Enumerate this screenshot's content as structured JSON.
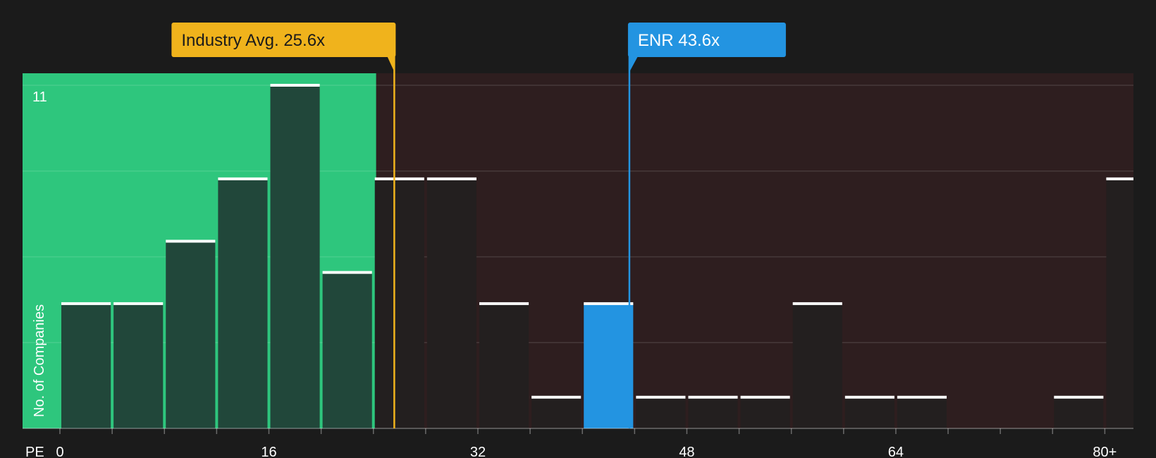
{
  "chart_data": {
    "type": "bar",
    "xlabel": "PE",
    "ylabel": "No. of Companies",
    "y_top_tick": "11",
    "ylim": [
      0,
      11.4
    ],
    "x_ticks": [
      {
        "value": 0,
        "label": "0"
      },
      {
        "value": 16,
        "label": "16"
      },
      {
        "value": 32,
        "label": "32"
      },
      {
        "value": 48,
        "label": "48"
      },
      {
        "value": 64,
        "label": "64"
      },
      {
        "value": 80,
        "label": "80+"
      }
    ],
    "bins": [
      {
        "x0": 0,
        "x1": 4,
        "count": 4
      },
      {
        "x0": 4,
        "x1": 8,
        "count": 4
      },
      {
        "x0": 8,
        "x1": 12,
        "count": 6
      },
      {
        "x0": 12,
        "x1": 16,
        "count": 8
      },
      {
        "x0": 16,
        "x1": 20,
        "count": 11
      },
      {
        "x0": 20,
        "x1": 24,
        "count": 5
      },
      {
        "x0": 24,
        "x1": 28,
        "count": 8
      },
      {
        "x0": 28,
        "x1": 32,
        "count": 8
      },
      {
        "x0": 32,
        "x1": 36,
        "count": 4
      },
      {
        "x0": 36,
        "x1": 40,
        "count": 1
      },
      {
        "x0": 40,
        "x1": 44,
        "count": 4,
        "highlight": true
      },
      {
        "x0": 44,
        "x1": 48,
        "count": 1
      },
      {
        "x0": 48,
        "x1": 52,
        "count": 1
      },
      {
        "x0": 52,
        "x1": 56,
        "count": 1
      },
      {
        "x0": 56,
        "x1": 60,
        "count": 4
      },
      {
        "x0": 60,
        "x1": 64,
        "count": 1
      },
      {
        "x0": 64,
        "x1": 68,
        "count": 1
      },
      {
        "x0": 68,
        "x1": 72,
        "count": 0
      },
      {
        "x0": 72,
        "x1": 76,
        "count": 0
      },
      {
        "x0": 76,
        "x1": 80,
        "count": 1
      },
      {
        "x0": 80,
        "x1": 84,
        "count": 8
      }
    ],
    "industry_avg": {
      "value": 25.6,
      "label": "Industry Avg. 25.6x",
      "color": "#f0b31c"
    },
    "company": {
      "value": 43.6,
      "label": "ENR 43.6x",
      "color": "#2394e1"
    },
    "colors": {
      "background": "#1b1b1b",
      "undervalued_region": "#2ec67d",
      "overvalued_region": "#2e1e1f",
      "bar_in_green": "#21473a",
      "bar_dark": "#231f1f",
      "bar_cap": "#ffffff"
    },
    "grid": true
  }
}
